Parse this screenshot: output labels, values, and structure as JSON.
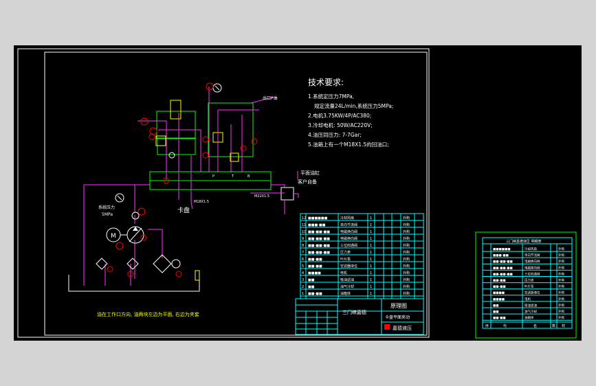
{
  "tech": {
    "title": "技术要求:",
    "items": [
      "1.系统定压力7MPa,",
      "规定流量24L/min,系统压力5MPa;",
      "2.电机3.75KW/4P/AC380;",
      "3.冷却电机: 50W/AC220V;",
      "4.油压同压力: 7-7Gar;",
      "5.油箱上有一个M18X1.5的回油口;"
    ]
  },
  "labels": {
    "outlet": "出口P油",
    "cylinder_1": "平面油缸",
    "cylinder_2": "客户自备",
    "pressure_1": "系统压力",
    "pressure_2": "5MPa",
    "chuck": "卡盘",
    "port_1": "M18X1.5",
    "port_2": "M22X1.5",
    "motor": "M",
    "port_p": "P",
    "port_t": "T",
    "port_b": "B",
    "note": "油在工作口方向, 油两块左边为平面, 右边为夹套"
  },
  "parts_table": {
    "rows": [
      {
        "code": "■■■■■■",
        "name": "冷却风扇",
        "qty": "1",
        "mat": "外购"
      },
      {
        "code": "■■■-■■",
        "name": "单向节流阀",
        "qty": "1",
        "mat": "外购"
      },
      {
        "code": "■■-■■-■■",
        "name": "电磁换向阀",
        "qty": "1",
        "mat": "外购"
      },
      {
        "code": "■■-■■-■■",
        "name": "电磁换向阀",
        "qty": "1",
        "mat": "外购"
      },
      {
        "code": "■■-■■-■■",
        "name": "三位四通阀",
        "qty": "1",
        "mat": "外购"
      },
      {
        "code": "■■-■■-■■",
        "name": "压力表",
        "qty": "1",
        "mat": "外购"
      },
      {
        "code": "■■-■■",
        "name": "叶片泵",
        "qty": "1",
        "mat": "外购"
      },
      {
        "code": "■■-■■",
        "name": "空滤器液位",
        "qty": "1",
        "mat": "外购"
      },
      {
        "code": "■■■■",
        "name": "电机",
        "qty": "1",
        "mat": "外购"
      },
      {
        "code": "■■",
        "name": "吸油滤油",
        "qty": "1",
        "mat": "外购"
      },
      {
        "code": "■■",
        "name": "油气冷却",
        "qty": "1",
        "mat": "外购"
      },
      {
        "code": "■■-■■",
        "name": "油箱体",
        "qty": "1",
        "mat": "外购"
      }
    ]
  },
  "title_block": {
    "drawing": "原理图",
    "project": "三门峡嘉德",
    "name": "卡盘平面夹动",
    "company": "嘉德液压"
  },
  "side_table": {
    "title": "三门峡嘉德液压 明细表",
    "rows": [
      {
        "code": "■■■■■■",
        "name": "冷却风扇",
        "mat": "外购"
      },
      {
        "code": "■■■-■■",
        "name": "单向节流阀",
        "mat": "外购"
      },
      {
        "code": "■■-■■-■■",
        "name": "电磁换向阀",
        "mat": "外购"
      },
      {
        "code": "■■-■■-■■",
        "name": "电磁换向阀",
        "mat": "外购"
      },
      {
        "code": "■■-■■-■■",
        "name": "三位四通阀",
        "mat": "外购"
      },
      {
        "code": "■■-■■",
        "name": "压力表",
        "mat": "外购"
      },
      {
        "code": "■■-■■",
        "name": "叶片泵",
        "mat": "外购"
      },
      {
        "code": "■■■■",
        "name": "空滤器液位",
        "mat": "外购"
      },
      {
        "code": "■■■■",
        "name": "电机",
        "mat": "外购"
      },
      {
        "code": "■■",
        "name": "吸油滤油",
        "mat": "外购"
      },
      {
        "code": "■■",
        "name": "油气冷却",
        "mat": "外购"
      },
      {
        "code": "■■-■■",
        "name": "油箱体",
        "mat": "外购"
      }
    ],
    "footer": [
      "序",
      "代",
      "名",
      "数",
      "材"
    ]
  },
  "colors": {
    "background": "#000000",
    "frame": "#ffffff",
    "circuit": "#ff33ff",
    "valve": "#00ff00",
    "table": "#00ffff",
    "balloon": "#ff0000"
  }
}
